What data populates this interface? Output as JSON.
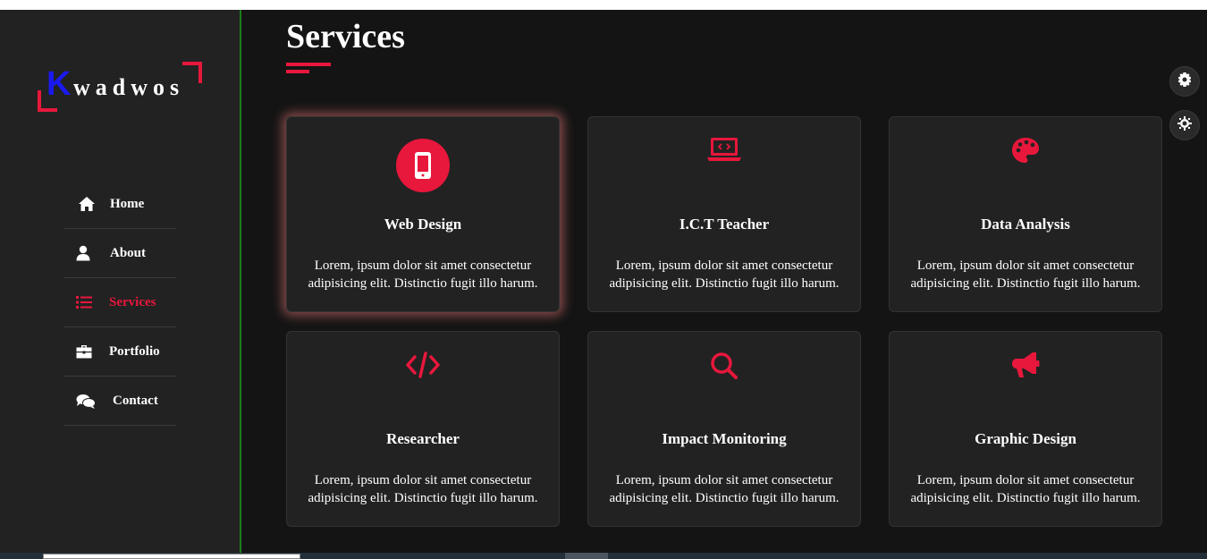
{
  "logo": {
    "initial": "K",
    "rest": "wadwos"
  },
  "sidebar": {
    "items": [
      {
        "label": "Home",
        "icon": "home-icon",
        "active": false
      },
      {
        "label": "About",
        "icon": "user-icon",
        "active": false
      },
      {
        "label": "Services",
        "icon": "list-icon",
        "active": true
      },
      {
        "label": "Portfolio",
        "icon": "briefcase-icon",
        "active": false
      },
      {
        "label": "Contact",
        "icon": "comments-icon",
        "active": false
      }
    ]
  },
  "main": {
    "title": "Services",
    "cards": [
      {
        "title": "Web Design",
        "icon": "mobile-icon",
        "text": "Lorem, ipsum dolor sit amet consectetur adipisicing elit. Distinctio fugit illo harum."
      },
      {
        "title": "I.C.T Teacher",
        "icon": "laptop-code-icon",
        "text": "Lorem, ipsum dolor sit amet consectetur adipisicing elit. Distinctio fugit illo harum."
      },
      {
        "title": "Data Analysis",
        "icon": "palette-icon",
        "text": "Lorem, ipsum dolor sit amet consectetur adipisicing elit. Distinctio fugit illo harum."
      },
      {
        "title": "Researcher",
        "icon": "code-icon",
        "text": "Lorem, ipsum dolor sit amet consectetur adipisicing elit. Distinctio fugit illo harum."
      },
      {
        "title": "Impact Monitoring",
        "icon": "search-icon",
        "text": "Lorem, ipsum dolor sit amet consectetur adipisicing elit. Distinctio fugit illo harum."
      },
      {
        "title": "Graphic Design",
        "icon": "bullhorn-icon",
        "text": "Lorem, ipsum dolor sit amet consectetur adipisicing elit. Distinctio fugit illo harum."
      }
    ]
  },
  "colors": {
    "accent": "#e8173c",
    "background": "#141414",
    "panel": "#222222",
    "logo_initial": "#1a1aee"
  }
}
